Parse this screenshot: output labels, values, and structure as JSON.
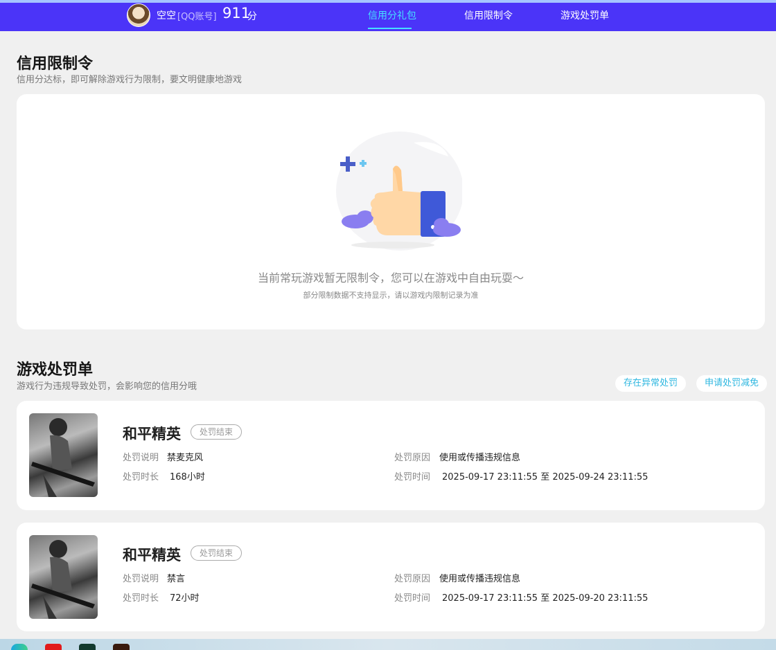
{
  "header": {
    "username": "空空",
    "account_type": "[QQ账号]",
    "score": "911",
    "score_unit": "分",
    "tabs": [
      {
        "label": "信用分礼包",
        "active": true
      },
      {
        "label": "信用限制令",
        "active": false
      },
      {
        "label": "游戏处罚单",
        "active": false
      }
    ]
  },
  "restriction": {
    "title": "信用限制令",
    "subtitle": "信用分达标，即可解除游戏行为限制，要文明健康地游戏",
    "empty_text": "当前常玩游戏暂无限制令，您可以在游戏中自由玩耍～",
    "empty_subtext": "部分限制数据不支持显示，请以游戏内限制记录为准"
  },
  "penalty": {
    "title": "游戏处罚单",
    "subtitle": "游戏行为违规导致处罚，会影响您的信用分哦",
    "button_abnormal": "存在异常处罚",
    "button_reduce": "申请处罚减免",
    "labels": {
      "description": "处罚说明",
      "duration": "处罚时长",
      "reason": "处罚原因",
      "time": "处罚时间"
    },
    "records": [
      {
        "game": "和平精英",
        "status": "处罚结束",
        "description": "禁麦克风",
        "duration": "168小时",
        "reason": "使用或传播违规信息",
        "time": "2025-09-17 23:11:55 至 2025-09-24 23:11:55"
      },
      {
        "game": "和平精英",
        "status": "处罚结束",
        "description": "禁言",
        "duration": "72小时",
        "reason": "使用或传播违规信息",
        "time": "2025-09-17 23:11:55 至 2025-09-20 23:11:55"
      }
    ]
  },
  "colors": {
    "header_bg": "#4b34f8",
    "active_tab": "#46e0ff",
    "link_blue": "#2eb7e0"
  }
}
